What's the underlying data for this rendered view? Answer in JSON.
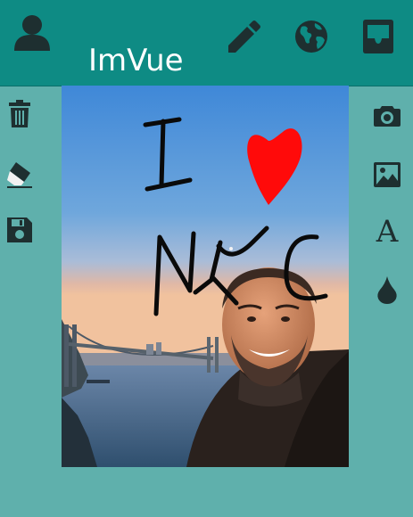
{
  "app": {
    "title": "ImVue"
  },
  "toolbar": {
    "profile_icon": "person-icon",
    "edit_icon": "pencil-icon",
    "globe_icon": "globe-icon",
    "inbox_icon": "inbox-tray-icon"
  },
  "left_tools": [
    {
      "icon": "trash-icon"
    },
    {
      "icon": "eraser-icon"
    },
    {
      "icon": "save-floppy-icon"
    }
  ],
  "right_tools": [
    {
      "icon": "camera-icon"
    },
    {
      "icon": "image-icon"
    },
    {
      "icon": "text-font-icon",
      "glyph": "A"
    },
    {
      "icon": "color-drop-icon"
    }
  ],
  "canvas": {
    "drawing_text_top": "I",
    "drawing_text_bottom": "NYC"
  },
  "colors": {
    "toolbar": "#0e8b84",
    "background": "#5fb0ac",
    "icon": "#1e2f30",
    "heart": "#ff0a0a"
  }
}
